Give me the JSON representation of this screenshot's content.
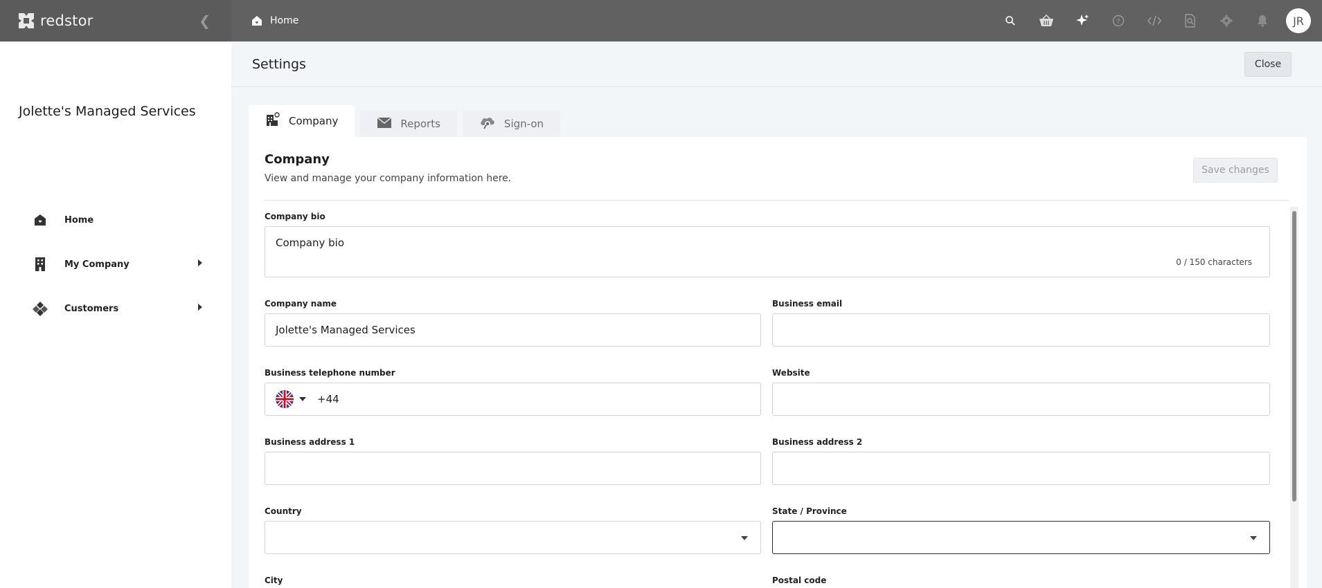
{
  "brand": {
    "name": "redstor"
  },
  "header": {
    "breadcrumb": "Home",
    "avatar_initials": "JR"
  },
  "top_icons": [
    "search-icon",
    "basket-icon",
    "sparkle-icon",
    "help-icon",
    "code-icon",
    "document-search-icon",
    "gear-icon",
    "bell-icon"
  ],
  "sidebar": {
    "org_name": "Jolette's Managed Services",
    "items": [
      {
        "label": "Home",
        "icon": "home-icon",
        "expandable": false
      },
      {
        "label": "My Company",
        "icon": "building-icon",
        "expandable": true
      },
      {
        "label": "Customers",
        "icon": "customers-icon",
        "expandable": true
      }
    ]
  },
  "settings": {
    "title": "Settings",
    "close_label": "Close",
    "tabs": [
      {
        "label": "Company",
        "icon": "company-icon",
        "active": true
      },
      {
        "label": "Reports",
        "icon": "envelope-icon",
        "active": false
      },
      {
        "label": "Sign-on",
        "icon": "cloud-key-icon",
        "active": false
      }
    ]
  },
  "company": {
    "title": "Company",
    "subtitle": "View and manage your company information here.",
    "save_label": "Save changes",
    "bio": {
      "label": "Company bio",
      "placeholder": "Company bio",
      "counter": "0 / 150 characters"
    },
    "fields": {
      "company_name": {
        "label": "Company name",
        "value": "Jolette's Managed Services"
      },
      "business_email": {
        "label": "Business email",
        "value": ""
      },
      "telephone": {
        "label": "Business telephone number",
        "value": "+44",
        "country": "GB"
      },
      "website": {
        "label": "Website",
        "value": ""
      },
      "address1": {
        "label": "Business address 1",
        "value": ""
      },
      "address2": {
        "label": "Business address 2",
        "value": ""
      },
      "country": {
        "label": "Country",
        "value": ""
      },
      "state": {
        "label": "State / Province",
        "value": ""
      },
      "city": {
        "label": "City",
        "value": ""
      },
      "postal_code": {
        "label": "Postal code",
        "value": ""
      }
    }
  },
  "colors": {
    "topbar": "#616161",
    "brand_bg": "#5b5b5b",
    "page_bg": "#f3f6f9",
    "focus_border": "#2a2a2a"
  }
}
